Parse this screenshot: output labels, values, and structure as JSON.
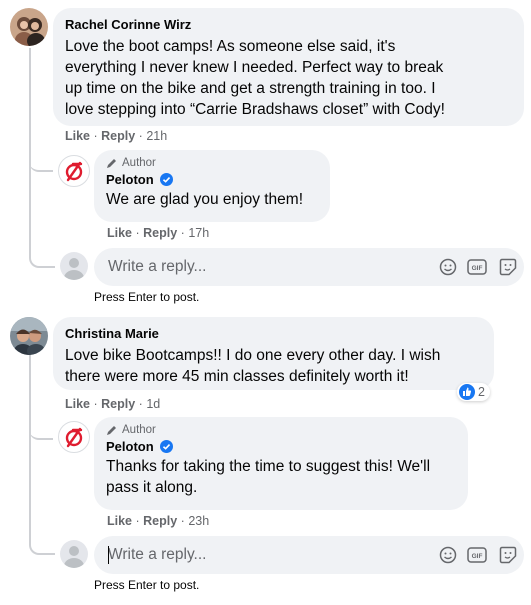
{
  "comments": [
    {
      "author": "Rachel Corinne Wirz",
      "text_lines": [
        "Love the boot camps! As someone else said, it's",
        "everything I never knew I needed. Perfect way to break",
        "up time on the bike and get a strength training in too. I",
        "love stepping into “Carrie Bradshaws closet” with Cody!"
      ],
      "actions": {
        "like": "Like",
        "reply": "Reply",
        "time": "21h"
      },
      "reply": {
        "badge": "Author",
        "author": "Peloton",
        "text_lines": [
          "We are glad you enjoy them!"
        ],
        "actions": {
          "like": "Like",
          "reply": "Reply",
          "time": "17h"
        }
      }
    },
    {
      "author": "Christina Marie",
      "text_lines": [
        "Love bike Bootcamps!! I do one every other day. I wish",
        "there were more 45 min classes definitely worth it!"
      ],
      "reactions": {
        "count": "2",
        "icon": "thumbs-up-icon"
      },
      "actions": {
        "like": "Like",
        "reply": "Reply",
        "time": "1d"
      },
      "reply": {
        "badge": "Author",
        "author": "Peloton",
        "text_lines": [
          "Thanks for taking the time to suggest this! We'll",
          "pass it along."
        ],
        "actions": {
          "like": "Like",
          "reply": "Reply",
          "time": "23h"
        }
      }
    }
  ],
  "reply_input": {
    "placeholder": "Write a reply...",
    "hint": "Press Enter to post."
  },
  "colors": {
    "bubble": "#f0f2f5",
    "accent": "#1877f2",
    "peloton": "#df1c2f",
    "meta": "#65676b"
  },
  "icons": [
    "emoji-icon",
    "gif-icon",
    "sticker-icon",
    "verified-icon",
    "pencil-icon"
  ]
}
